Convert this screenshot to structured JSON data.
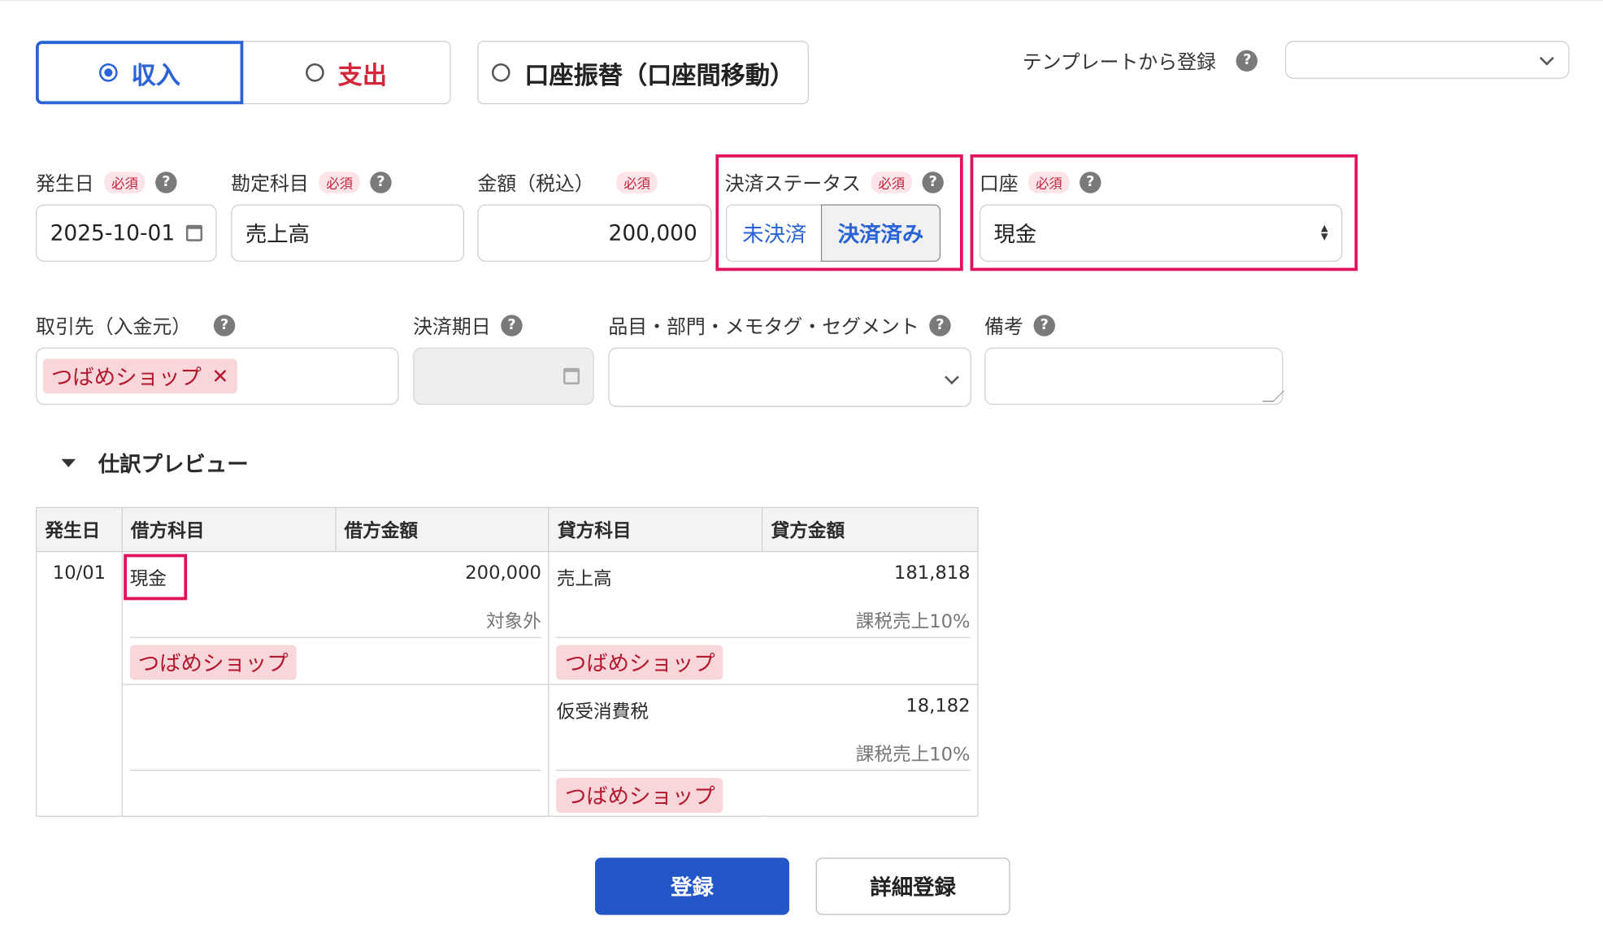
{
  "type_selector": {
    "income": "収入",
    "expense": "支出",
    "transfer": "口座振替（口座間移動）"
  },
  "template": {
    "label": "テンプレートから登録",
    "value": ""
  },
  "help_glyph": "?",
  "required_badge": "必須",
  "fields": {
    "date": {
      "label": "発生日",
      "value": "2025-10-01"
    },
    "account_title": {
      "label": "勘定科目",
      "value": "売上高"
    },
    "amount": {
      "label": "金額（税込）",
      "value": "200,000"
    },
    "status": {
      "label": "決済ステータス",
      "unpaid": "未決済",
      "paid": "決済済み",
      "selected": "paid"
    },
    "wallet": {
      "label": "口座",
      "value": "現金"
    },
    "partner": {
      "label": "取引先（入金元）",
      "tag": "つばめショップ",
      "remove_glyph": "✕"
    },
    "due_date": {
      "label": "決済期日",
      "value": ""
    },
    "tags": {
      "label": "品目・部門・メモタグ・セグメント",
      "value": ""
    },
    "memo": {
      "label": "備考",
      "value": ""
    }
  },
  "preview": {
    "title": "仕訳プレビュー",
    "headers": {
      "date": "発生日",
      "debit_account": "借方科目",
      "debit_amount": "借方金額",
      "credit_account": "貸方科目",
      "credit_amount": "貸方金額"
    },
    "row": {
      "date": "10/01",
      "debit": {
        "account": "現金",
        "amount": "200,000",
        "tax": "対象外",
        "partner": "つばめショップ"
      },
      "credit": [
        {
          "account": "売上高",
          "amount": "181,818",
          "tax": "課税売上10%",
          "partner": "つばめショップ"
        },
        {
          "account": "仮受消費税",
          "amount": "18,182",
          "tax": "課税売上10%",
          "partner": "つばめショップ"
        }
      ]
    }
  },
  "buttons": {
    "register": "登録",
    "detail_register": "詳細登録"
  },
  "colors": {
    "primary": "#2356c6",
    "selected_border": "#2a63d6",
    "expense_red": "#d2273a",
    "highlight": "#e0125d",
    "tag_bg": "#f8d6da"
  }
}
